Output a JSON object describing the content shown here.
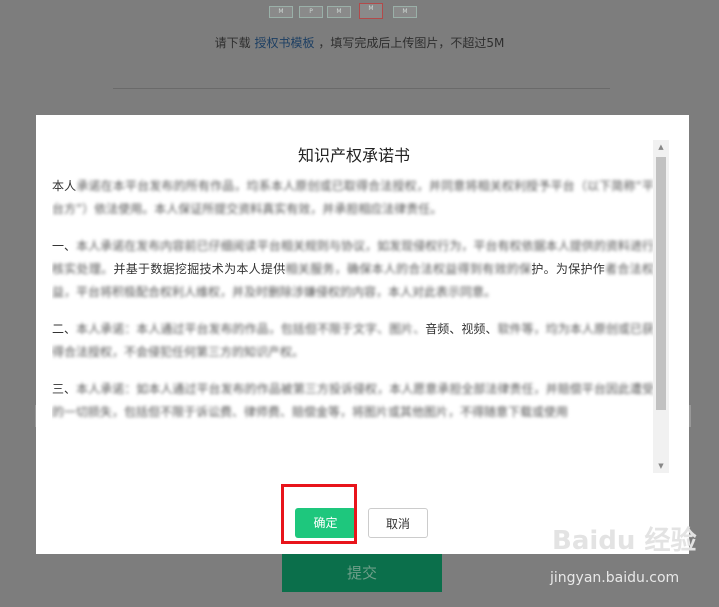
{
  "background": {
    "thumbnails": [
      "M",
      "P",
      "M",
      "M",
      "M"
    ],
    "hint_prefix": "请下载",
    "hint_link": "授权书模板",
    "hint_suffix": "，填写完成后上传图片，不超过5M",
    "submit_label": "提交"
  },
  "modal": {
    "title": "知识产权承诺书",
    "paragraphs": [
      {
        "visible": "本人",
        "blurred": "承诺在本平台发布的所有作品，均系本人原创或已取得合法授权，并同意将相关权利授予平台（以下简称“平台方”）依法使用。本人保证所提交资料真实有效，并承担相应法律责任。"
      },
      {
        "visible": "一、",
        "blurred": "本人承诺在发布内容前已仔细阅读平台相关规则与协议，如发现侵权行为，平台有权依据本人提供的资料进行核实处理。",
        "mid_visible": "并基于数据挖掘技术为本人提供",
        "blurred2": "相关服务，确保本人的合法权益得到有效的保",
        "tail_visible": "护。为保护作",
        "blurred3": "者合法权益，平台将积极配合权利人维权，并及时删除涉嫌侵权的内容，本人对此表示同意。"
      },
      {
        "visible": "二、",
        "blurred": "本人承诺：本人通过平台发布的作品，包括但不限于文字、图片、",
        "mid_visible": "音频、视频、",
        "blurred2": "软件等，均为本人原创或已获得合法授权，不会侵犯任何第三方的知识产权。"
      },
      {
        "visible": "三、",
        "blurred": "本人承诺：如本人通过平台发布的作品被第三方投诉侵权，本人愿意承担全部法律责任，并赔偿平台因此遭受的一切损失，包括但不限于诉讼费、律师费、赔偿金等，",
        "tail_visible": "将图片或其他图片，不得随意下载或使用"
      }
    ],
    "ok_label": "确定",
    "cancel_label": "取消"
  },
  "watermark": {
    "logo": "Baidu 经验",
    "url": "jingyan.baidu.com"
  }
}
